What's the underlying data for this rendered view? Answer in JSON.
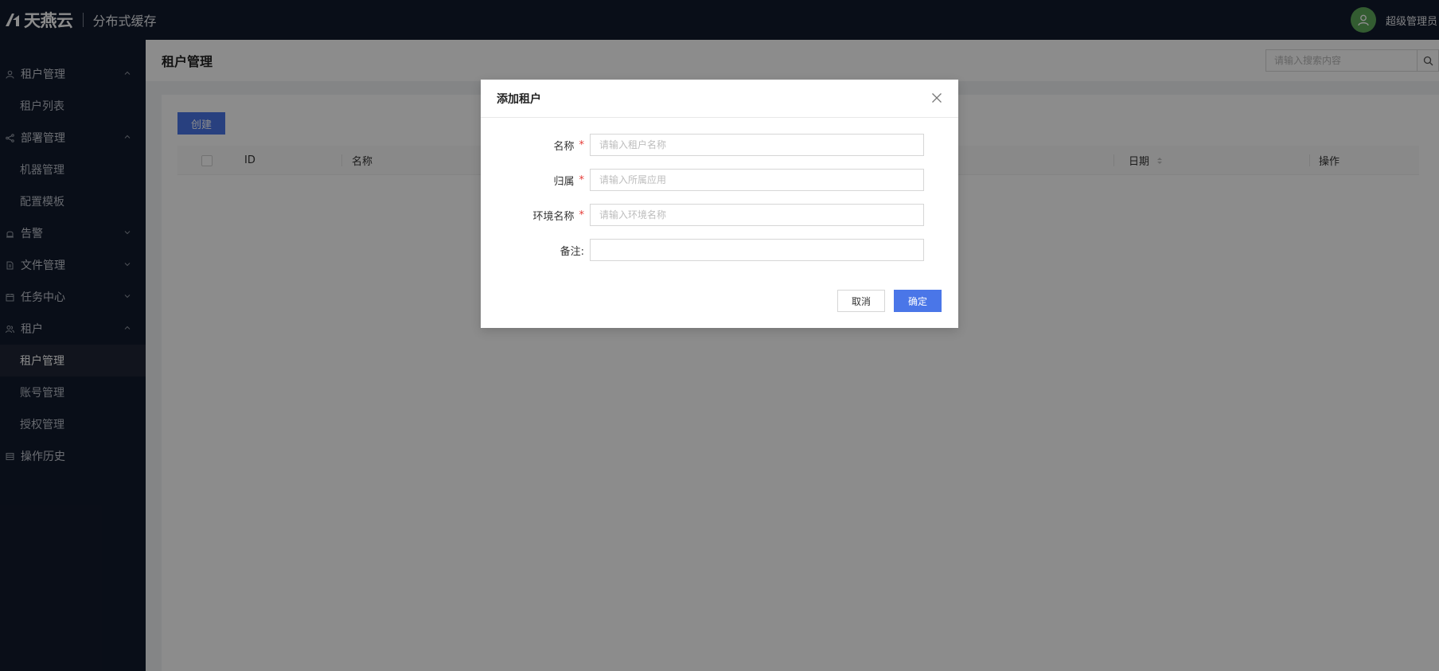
{
  "brand": {
    "logo_text": "天燕云",
    "app_name": "分布式缓存"
  },
  "user": {
    "name": "超级管理员"
  },
  "sidebar": {
    "groups": [
      {
        "label": "租户管理",
        "icon": "user-icon",
        "expanded": true,
        "items": [
          {
            "label": "租户列表"
          }
        ]
      },
      {
        "label": "部署管理",
        "icon": "share-icon",
        "expanded": true,
        "items": [
          {
            "label": "机器管理"
          },
          {
            "label": "配置模板"
          }
        ]
      },
      {
        "label": "告警",
        "icon": "alarm-icon",
        "expanded": false,
        "items": []
      },
      {
        "label": "文件管理",
        "icon": "file-icon",
        "expanded": false,
        "items": []
      },
      {
        "label": "任务中心",
        "icon": "calendar-icon",
        "expanded": false,
        "items": []
      },
      {
        "label": "租户",
        "icon": "users-icon",
        "expanded": true,
        "items": [
          {
            "label": "租户管理",
            "active": true
          },
          {
            "label": "账号管理"
          },
          {
            "label": "授权管理"
          }
        ]
      },
      {
        "label": "操作历史",
        "icon": "list-icon",
        "expanded": false,
        "items": []
      }
    ]
  },
  "page": {
    "title": "租户管理",
    "search_placeholder": "请输入搜索内容",
    "create_label": "创建",
    "columns": {
      "id": "ID",
      "name": "名称",
      "date": "日期",
      "actions": "操作"
    }
  },
  "modal": {
    "title": "添加租户",
    "fields": [
      {
        "label": "名称",
        "required": true,
        "placeholder": "请输入租户名称",
        "value": ""
      },
      {
        "label": "归属",
        "required": true,
        "placeholder": "请输入所属应用",
        "value": ""
      },
      {
        "label": "环境名称",
        "required": true,
        "placeholder": "请输入环境名称",
        "value": ""
      },
      {
        "label": "备注:",
        "required": false,
        "placeholder": "",
        "value": ""
      }
    ],
    "cancel_label": "取消",
    "ok_label": "确定",
    "required_mark": "*"
  },
  "colors": {
    "topbar": "#121a2c",
    "primary": "#4a76e8",
    "required": "#e53935",
    "avatar": "#5ea85a"
  }
}
